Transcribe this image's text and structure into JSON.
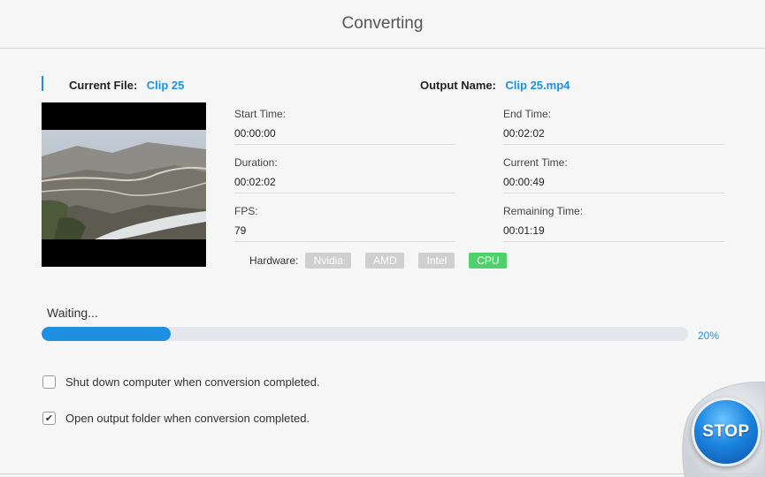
{
  "window": {
    "title": "Converting"
  },
  "file": {
    "current_file_label": "Current File:",
    "current_file_value": "Clip 25",
    "output_name_label": "Output Name:",
    "output_name_value": "Clip 25.mp4"
  },
  "stats": {
    "start_time_label": "Start Time:",
    "start_time_value": "00:00:00",
    "end_time_label": "End Time:",
    "end_time_value": "00:02:02",
    "duration_label": "Duration:",
    "duration_value": "00:02:02",
    "current_time_label": "Current Time:",
    "current_time_value": "00:00:49",
    "fps_label": "FPS:",
    "fps_value": "79",
    "remaining_label": "Remaining Time:",
    "remaining_value": "00:01:19"
  },
  "hardware": {
    "label": "Hardware:",
    "options": [
      "Nvidia",
      "AMD",
      "Intel",
      "CPU"
    ],
    "active": "CPU"
  },
  "progress": {
    "status": "Waiting...",
    "percent_text": "20%",
    "fraction": 0.2
  },
  "options": {
    "shutdown_label": "Shut down computer when conversion completed.",
    "shutdown_checked": false,
    "open_folder_label": "Open output folder when conversion completed.",
    "open_folder_checked": true
  },
  "stop_button": {
    "label": "STOP"
  },
  "colors": {
    "accent": "#1e8fe1",
    "active_chip": "#4ed16b",
    "inactive_chip": "#cfcfcf"
  }
}
